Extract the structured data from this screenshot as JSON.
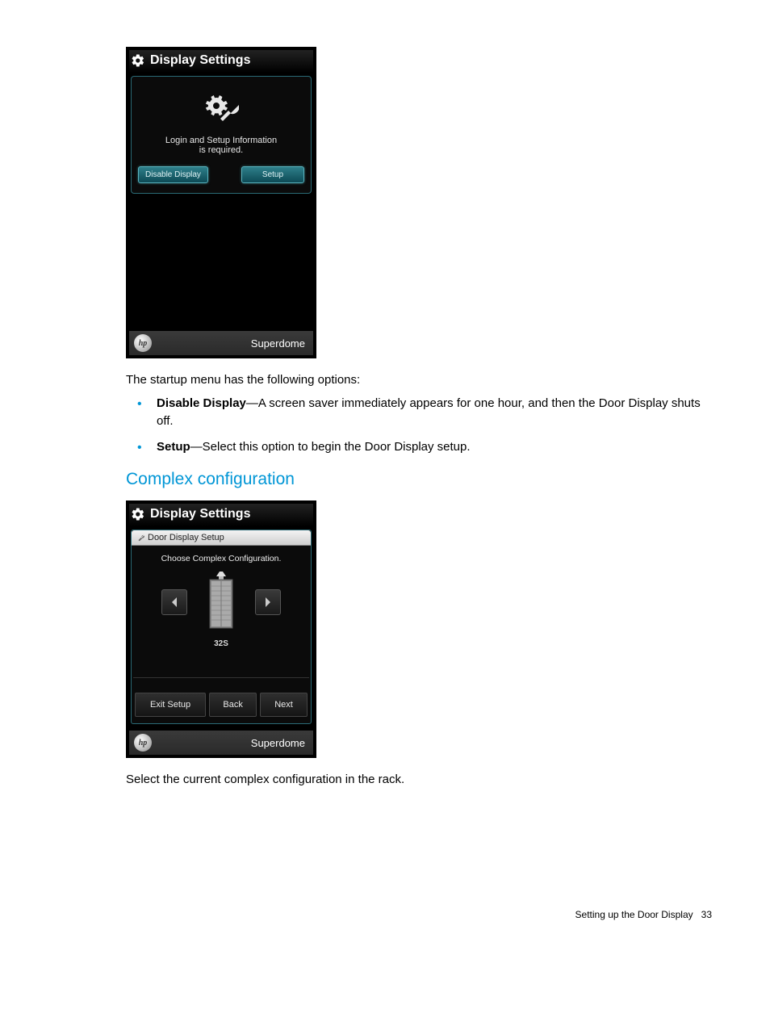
{
  "screenshot1": {
    "title": "Display Settings",
    "message_line1": "Login and Setup Information",
    "message_line2": "is required.",
    "btn_disable": "Disable Display",
    "btn_setup": "Setup",
    "footer_brand": "Superdome",
    "hp_label": "hp"
  },
  "text": {
    "intro": "The startup menu has the following options:",
    "bullet1_bold": "Disable Display",
    "bullet1_rest": "—A screen saver immediately appears for one hour, and then the Door Display shuts off.",
    "bullet2_bold": "Setup",
    "bullet2_rest": "—Select this option to begin the Door Display setup.",
    "heading": "Complex configuration",
    "after": "Select the current complex configuration in the rack."
  },
  "screenshot2": {
    "title": "Display Settings",
    "subheader": "Door Display Setup",
    "choose": "Choose Complex Configuration.",
    "rack_label": "32S",
    "btn_exit": "Exit Setup",
    "btn_back": "Back",
    "btn_next": "Next",
    "footer_brand": "Superdome",
    "hp_label": "hp"
  },
  "footer": {
    "section": "Setting up the Door Display",
    "page": "33"
  }
}
